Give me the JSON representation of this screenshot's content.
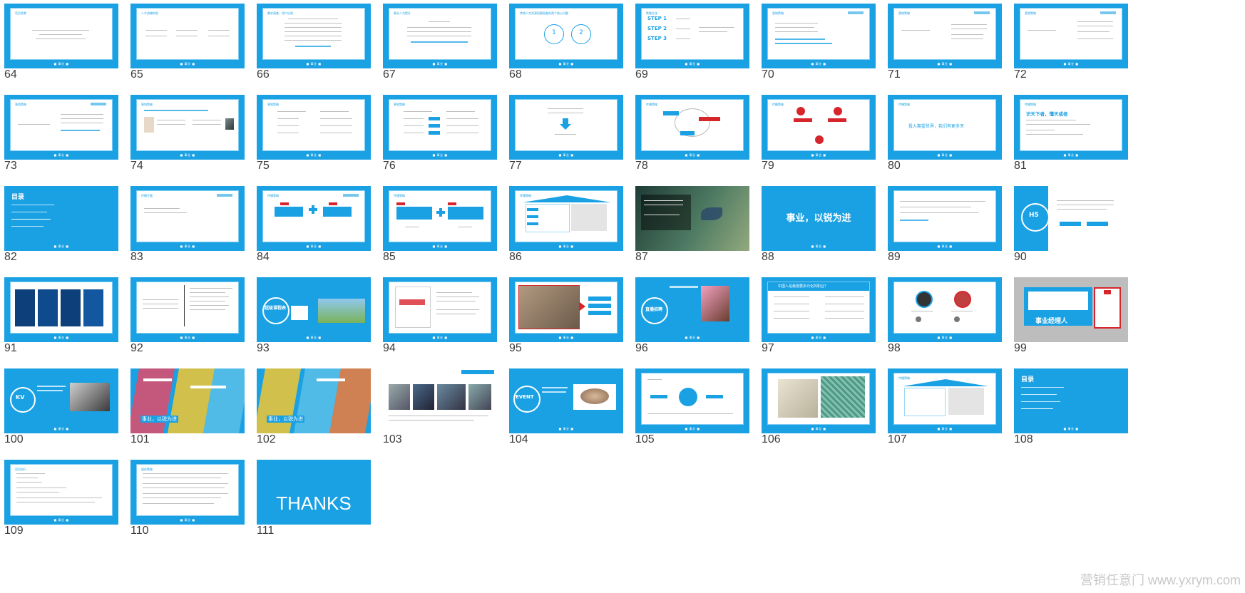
{
  "slides": {
    "s64": {
      "number": "64",
      "title": "项目背景"
    },
    "s65": {
      "number": "65",
      "title": "人才战略构思"
    },
    "s66": {
      "number": "66",
      "title": "需求调查，用户反馈"
    },
    "s67": {
      "number": "67",
      "title": "事业人力提升"
    },
    "s68": {
      "number": "68",
      "title": "传统人力资源招募面临的两个核心问题",
      "c1": "1",
      "c2": "2"
    },
    "s69": {
      "number": "69",
      "title": "策略主张",
      "step1": "STEP 1",
      "step2": "STEP 2",
      "step3": "STEP 3"
    },
    "s70": {
      "number": "70",
      "title": "营销策略"
    },
    "s71": {
      "number": "71",
      "title": "营销策略"
    },
    "s72": {
      "number": "72",
      "title": "营销策略"
    },
    "s73": {
      "number": "73",
      "title": "营销策略"
    },
    "s74": {
      "number": "74",
      "title": "营销策略"
    },
    "s75": {
      "number": "75",
      "title": "营销策略"
    },
    "s76": {
      "number": "76",
      "title": "营销策略"
    },
    "s77": {
      "number": "77",
      "title": ""
    },
    "s78": {
      "number": "78",
      "title": "传播策略"
    },
    "s79": {
      "number": "79",
      "title": "传播策略"
    },
    "s80": {
      "number": "80",
      "title": "传播策略",
      "body": "投入期望世界，我们有更多天"
    },
    "s81": {
      "number": "81",
      "title": "传播策略",
      "body": "识天下者，懂天或者"
    },
    "s82": {
      "number": "82",
      "title": "目录"
    },
    "s83": {
      "number": "83",
      "title": "传播主题"
    },
    "s84": {
      "number": "84",
      "title": "传播策略"
    },
    "s85": {
      "number": "85",
      "title": "传播策略"
    },
    "s86": {
      "number": "86",
      "title": "传播策略"
    },
    "s87": {
      "number": "87",
      "title": ""
    },
    "s88": {
      "number": "88",
      "title": "事业，以锐为进"
    },
    "s89": {
      "number": "89",
      "title": ""
    },
    "s90": {
      "number": "90",
      "title": "H5"
    },
    "s91": {
      "number": "91",
      "title": ""
    },
    "s92": {
      "number": "92",
      "title": ""
    },
    "s93": {
      "number": "93",
      "title": "超级课程表"
    },
    "s94": {
      "number": "94",
      "title": ""
    },
    "s95": {
      "number": "95",
      "title": ""
    },
    "s96": {
      "number": "96",
      "title": "直播招聘"
    },
    "s97": {
      "number": "97",
      "title": "中国人是最需要多元化的职业？"
    },
    "s98": {
      "number": "98",
      "title": ""
    },
    "s99": {
      "number": "99",
      "title": "事业经理人"
    },
    "s100": {
      "number": "100",
      "title": "KV"
    },
    "s101": {
      "number": "101",
      "title": "事业，以锐为进"
    },
    "s102": {
      "number": "102",
      "title": "事业，以锐为进"
    },
    "s103": {
      "number": "103",
      "title": ""
    },
    "s104": {
      "number": "104",
      "title": "EVENT"
    },
    "s105": {
      "number": "105",
      "title": ""
    },
    "s106": {
      "number": "106",
      "title": ""
    },
    "s107": {
      "number": "107",
      "title": "传播策略"
    },
    "s108": {
      "number": "108",
      "title": "目录"
    },
    "s109": {
      "number": "109",
      "title": "项目执行"
    },
    "s110": {
      "number": "110",
      "title": "媒体策略"
    },
    "s111": {
      "number": "111",
      "title": "THANKS"
    }
  },
  "watermark": "营销任意门 www.yxrym.com",
  "colors": {
    "accent": "#1aa1e3",
    "red": "#d7252c",
    "frame_border": "#7fcdf3"
  }
}
